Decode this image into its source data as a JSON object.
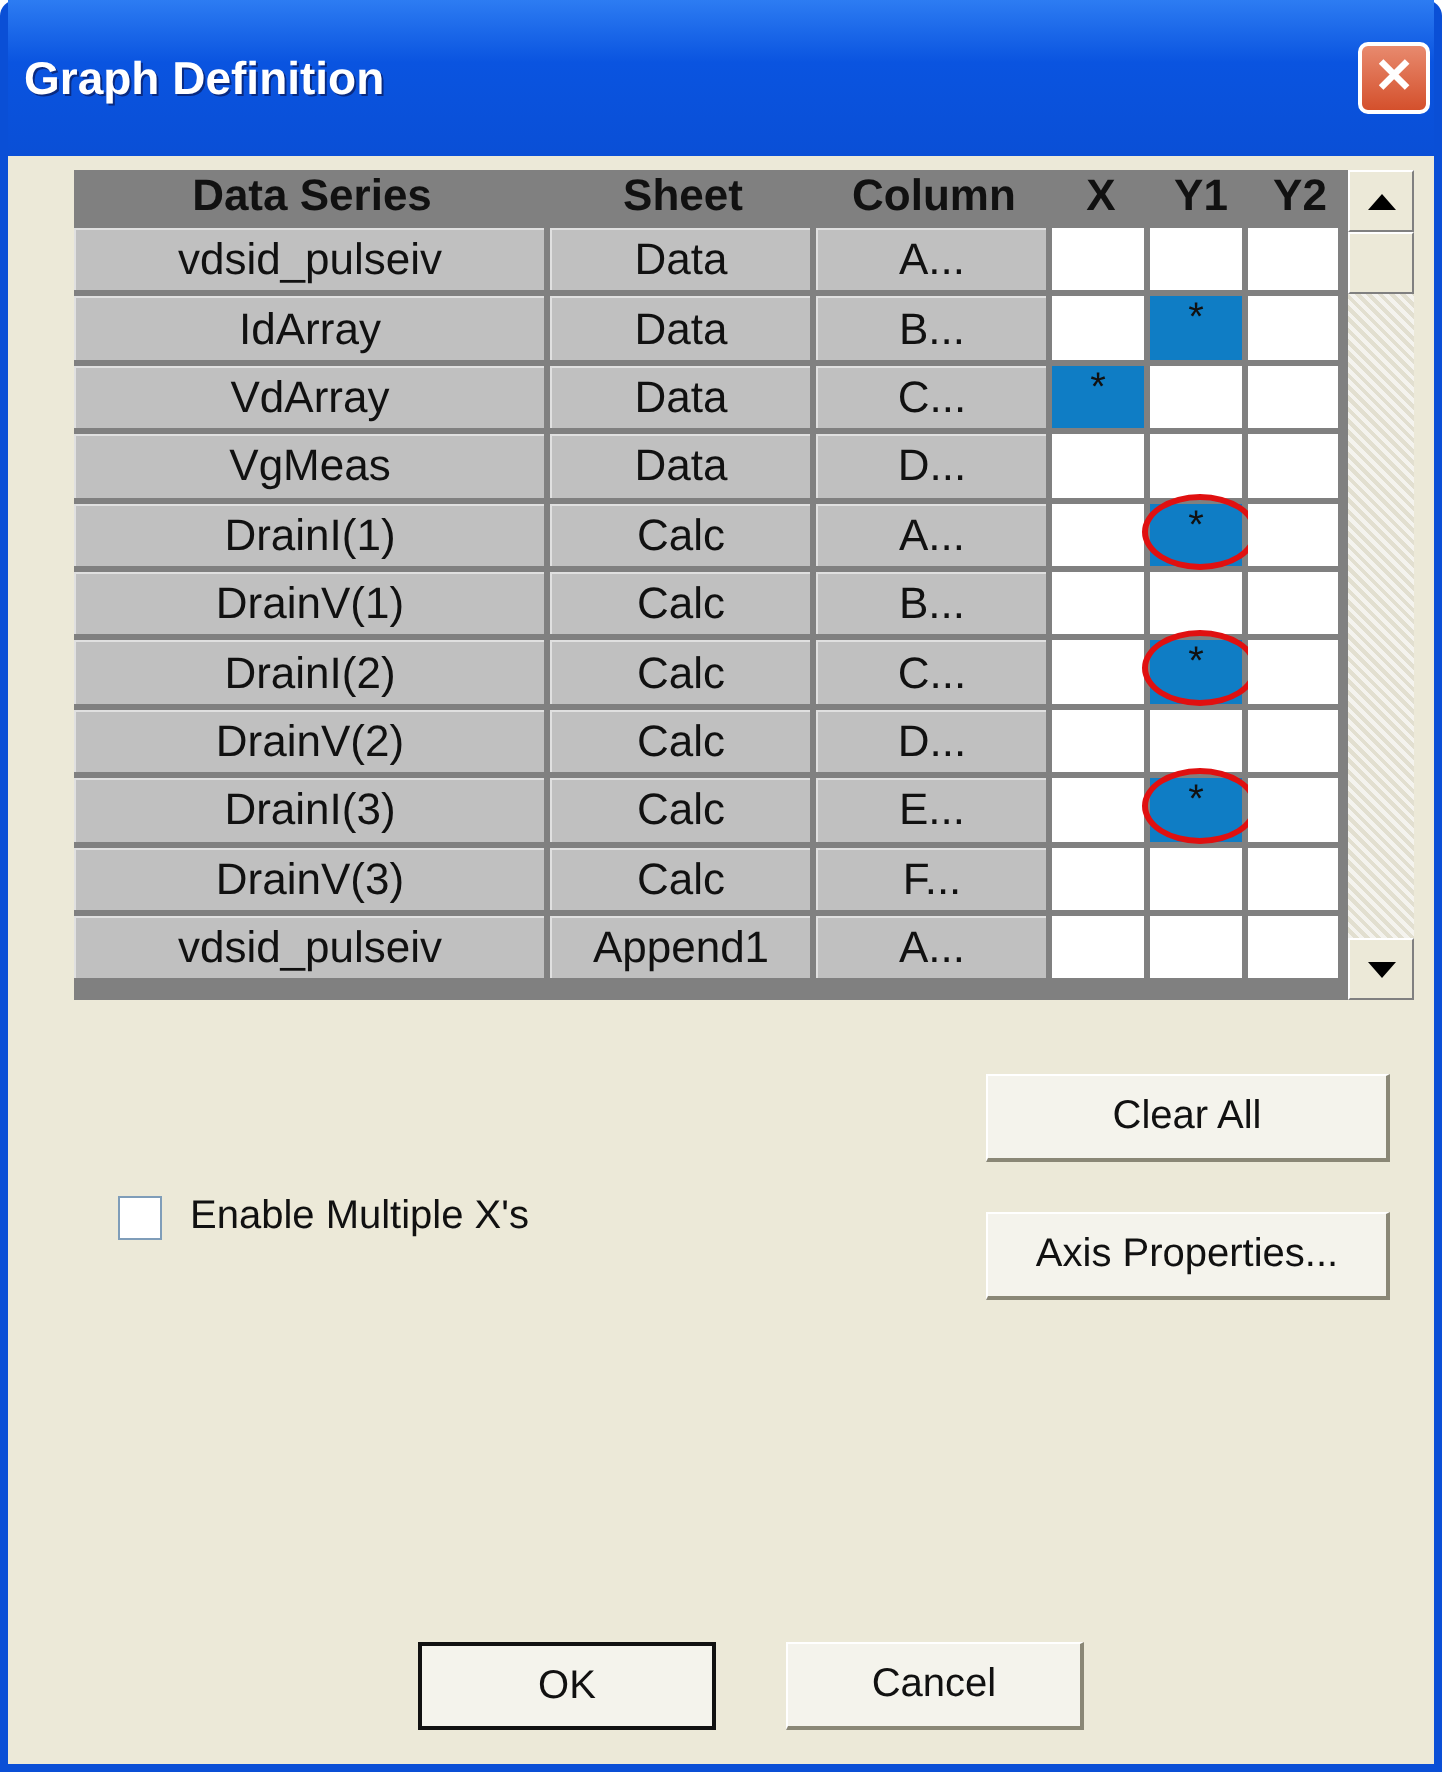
{
  "window": {
    "title": "Graph Definition",
    "close": "✕"
  },
  "table": {
    "columns": [
      "Data Series",
      "Sheet",
      "Column",
      "X",
      "Y1",
      "Y2"
    ],
    "rows": [
      {
        "series": "vdsid_pulseiv",
        "sheet": "Data",
        "column": "A...",
        "flags": [
          {
            "selected": false
          },
          {
            "selected": false
          },
          {
            "selected": false
          }
        ]
      },
      {
        "series": "IdArray",
        "sheet": "Data",
        "column": "B...",
        "flags": [
          {
            "selected": false
          },
          {
            "selected": true,
            "text": "*",
            "circled": false
          },
          {
            "selected": false
          }
        ]
      },
      {
        "series": "VdArray",
        "sheet": "Data",
        "column": "C...",
        "flags": [
          {
            "selected": true,
            "text": "*",
            "circled": false
          },
          {
            "selected": false
          },
          {
            "selected": false
          }
        ]
      },
      {
        "series": "VgMeas",
        "sheet": "Data",
        "column": "D...",
        "flags": [
          {
            "selected": false
          },
          {
            "selected": false
          },
          {
            "selected": false
          }
        ]
      },
      {
        "series": "DrainI(1)",
        "sheet": "Calc",
        "column": "A...",
        "flags": [
          {
            "selected": false
          },
          {
            "selected": true,
            "text": "*",
            "circled": true
          },
          {
            "selected": false
          }
        ]
      },
      {
        "series": "DrainV(1)",
        "sheet": "Calc",
        "column": "B...",
        "flags": [
          {
            "selected": false
          },
          {
            "selected": false
          },
          {
            "selected": false
          }
        ]
      },
      {
        "series": "DrainI(2)",
        "sheet": "Calc",
        "column": "C...",
        "flags": [
          {
            "selected": false
          },
          {
            "selected": true,
            "text": "*",
            "circled": true
          },
          {
            "selected": false
          }
        ]
      },
      {
        "series": "DrainV(2)",
        "sheet": "Calc",
        "column": "D...",
        "flags": [
          {
            "selected": false
          },
          {
            "selected": false
          },
          {
            "selected": false
          }
        ]
      },
      {
        "series": "DrainI(3)",
        "sheet": "Calc",
        "column": "E...",
        "flags": [
          {
            "selected": false
          },
          {
            "selected": true,
            "text": "*",
            "circled": true
          },
          {
            "selected": false
          }
        ]
      },
      {
        "series": "DrainV(3)",
        "sheet": "Calc",
        "column": "F...",
        "flags": [
          {
            "selected": false
          },
          {
            "selected": false
          },
          {
            "selected": false
          }
        ]
      },
      {
        "series": "vdsid_pulseiv",
        "sheet": "Append1",
        "column": "A...",
        "flags": [
          {
            "selected": false
          },
          {
            "selected": false
          },
          {
            "selected": false
          }
        ]
      }
    ]
  },
  "buttons": {
    "clear_all": "Clear All",
    "axis_properties": "Axis Properties...",
    "ok": "OK",
    "cancel": "Cancel"
  },
  "enable_multiple_x": {
    "label": "Enable Multiple X's",
    "checked": false
  }
}
